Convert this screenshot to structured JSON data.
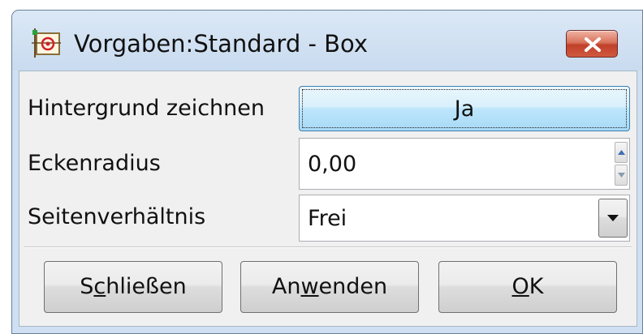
{
  "window": {
    "title": "Vorgaben:Standard - Box",
    "icon": "app-icon"
  },
  "form": {
    "background": {
      "label": "Hintergrund zeichnen",
      "value": "Ja"
    },
    "corner_radius": {
      "label": "Eckenradius",
      "value": "0,00"
    },
    "aspect_ratio": {
      "label": "Seitenverhältnis",
      "value": "Frei"
    }
  },
  "buttons": {
    "close": {
      "pre": "S",
      "mnemonic": "c",
      "post": "hließen"
    },
    "apply": {
      "pre": "An",
      "mnemonic": "w",
      "post": "enden"
    },
    "ok": {
      "pre": "",
      "mnemonic": "O",
      "post": "K"
    }
  },
  "colors": {
    "close_button": "#c0402a",
    "toggle_button": "#bee6fd",
    "titlebar": "#cfe0f2"
  }
}
